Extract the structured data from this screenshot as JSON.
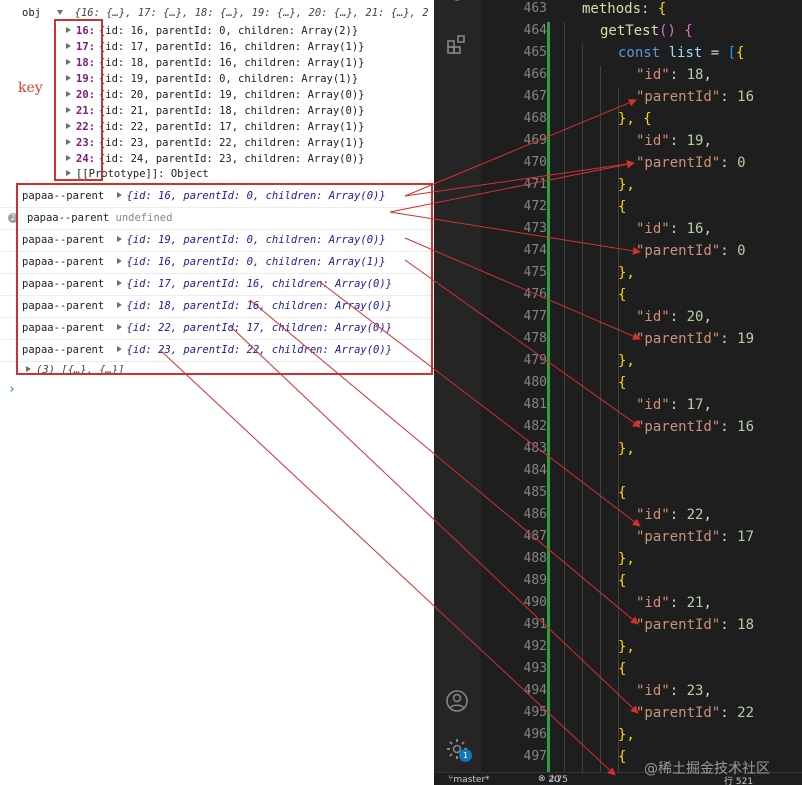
{
  "console": {
    "obj_label": "obj",
    "obj_summary": "{16: {…}, 17: {…}, 18: {…}, 19: {…}, 20: {…}, 21: {…}, 2",
    "entries": [
      {
        "key": "16:",
        "value": "{id: 16, parentId: 0, children: Array(2)}"
      },
      {
        "key": "17:",
        "value": "{id: 17, parentId: 16, children: Array(1)}"
      },
      {
        "key": "18:",
        "value": "{id: 18, parentId: 16, children: Array(1)}"
      },
      {
        "key": "19:",
        "value": "{id: 19, parentId: 0, children: Array(1)}"
      },
      {
        "key": "20:",
        "value": "{id: 20, parentId: 19, children: Array(0)}"
      },
      {
        "key": "21:",
        "value": "{id: 21, parentId: 18, children: Array(0)}"
      },
      {
        "key": "22:",
        "value": "{id: 22, parentId: 17, children: Array(1)}"
      },
      {
        "key": "23:",
        "value": "{id: 23, parentId: 22, children: Array(1)}"
      },
      {
        "key": "24:",
        "value": "{id: 24, parentId: 23, children: Array(0)}"
      }
    ],
    "prototype": "[[Prototype]]: Object",
    "key_annotation": "key",
    "logs": [
      {
        "label": "papaa--parent",
        "value": "{id: 16, parentId: 0, children: Array(0)}"
      },
      {
        "label": "papaa--parent",
        "value": "undefined",
        "is_undefined": true
      },
      {
        "label": "papaa--parent",
        "value": "{id: 19, parentId: 0, children: Array(0)}"
      },
      {
        "label": "papaa--parent",
        "value": "{id: 16, parentId: 0, children: Array(1)}"
      },
      {
        "label": "papaa--parent",
        "value": "{id: 17, parentId: 16, children: Array(0)}"
      },
      {
        "label": "papaa--parent",
        "value": "{id: 18, parentId: 16, children: Array(0)}"
      },
      {
        "label": "papaa--parent",
        "value": "{id: 22, parentId: 17, children: Array(0)}"
      },
      {
        "label": "papaa--parent",
        "value": "{id: 23, parentId: 22, children: Array(0)}"
      }
    ],
    "array_summary": "(3) [{…}, {…}]",
    "prompt": "›"
  },
  "editor": {
    "line_numbers": [
      "463",
      "464",
      "465",
      "466",
      "467",
      "468",
      "469",
      "470",
      "471",
      "472",
      "473",
      "474",
      "475",
      "476",
      "477",
      "478",
      "479",
      "480",
      "481",
      "482",
      "483",
      "484",
      "485",
      "486",
      "487",
      "488",
      "489",
      "490",
      "491",
      "492",
      "493",
      "494",
      "495",
      "496",
      "497"
    ],
    "code": {
      "methods": "methods",
      "colon": ":",
      "open_brace": "{",
      "fn_name": "getTest",
      "parens": "()",
      "kw_const": "const",
      "var_list": "list",
      "assign": " = ",
      "open_bracket": "[",
      "id_key": "\"id\"",
      "parent_key": "\"parentId\"",
      "close_open": "}, {",
      "close_comma": "},",
      "records": [
        {
          "id": "18",
          "parentId": "16"
        },
        {
          "id": "19",
          "parentId": "0"
        },
        {
          "id": "16",
          "parentId": "0"
        },
        {
          "id": "20",
          "parentId": "19"
        },
        {
          "id": "17",
          "parentId": "16"
        },
        {
          "id": "22",
          "parentId": "17"
        },
        {
          "id": "21",
          "parentId": "18"
        },
        {
          "id": "23",
          "parentId": "22"
        }
      ]
    },
    "status": {
      "branch": "master*",
      "errors": "20",
      "warnings": "75",
      "position": "行 521"
    },
    "notification_count": "1",
    "icons": [
      "extensions-icon",
      "account-icon",
      "settings-gear-icon"
    ]
  },
  "watermark": "@稀土掘金技术社区",
  "colors": {
    "annotation_red": "#d32f2f",
    "git_added": "#2ea043"
  }
}
